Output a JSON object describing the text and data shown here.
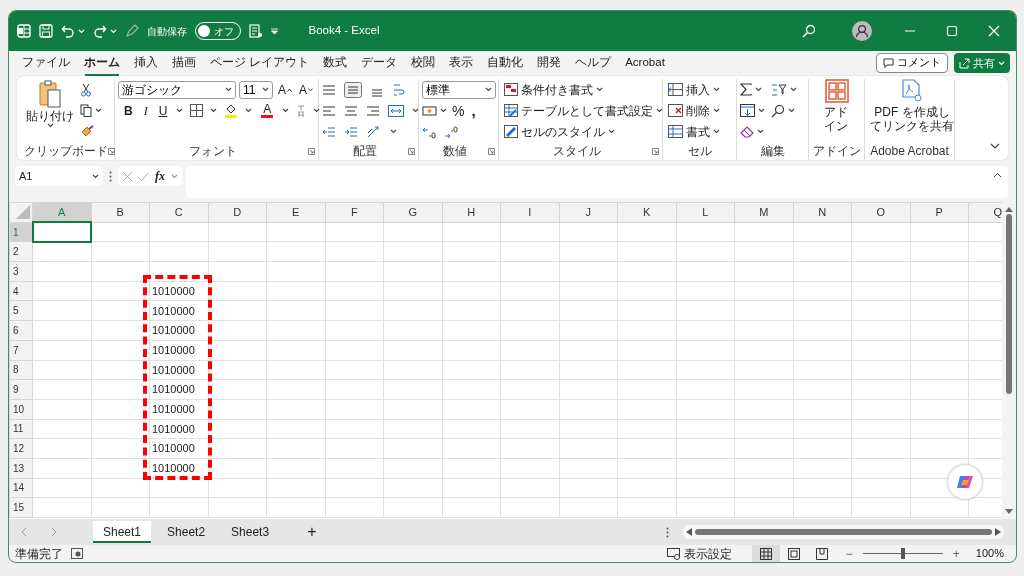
{
  "title_bar": {
    "autosave_label": "自動保存",
    "autosave_toggle": {
      "label": "オフ",
      "on": false
    },
    "title": "Book4 - Excel"
  },
  "menu_tabs": [
    {
      "label": "ファイル",
      "selected": false
    },
    {
      "label": "ホーム",
      "selected": true
    },
    {
      "label": "挿入",
      "selected": false
    },
    {
      "label": "描画",
      "selected": false
    },
    {
      "label": "ページ レイアウト",
      "selected": false
    },
    {
      "label": "数式",
      "selected": false
    },
    {
      "label": "データ",
      "selected": false
    },
    {
      "label": "校閲",
      "selected": false
    },
    {
      "label": "表示",
      "selected": false
    },
    {
      "label": "自動化",
      "selected": false
    },
    {
      "label": "開発",
      "selected": false
    },
    {
      "label": "ヘルプ",
      "selected": false
    },
    {
      "label": "Acrobat",
      "selected": false
    }
  ],
  "comment_button": "コメント",
  "share_button": "共有",
  "ribbon": {
    "clipboard": {
      "paste": "貼り付け",
      "label": "クリップボード"
    },
    "font": {
      "font_name": "游ゴシック",
      "font_size": "11",
      "grow": "A",
      "shrink": "A",
      "bold": "B",
      "italic": "I",
      "underline": "U",
      "font_color": "A",
      "label": "フォント"
    },
    "alignment": {
      "label": "配置"
    },
    "number": {
      "format": "標準",
      "percent": "%",
      "comma": ",",
      "label": "数値"
    },
    "styles": {
      "items": [
        "条件付き書式",
        "テーブルとして書式設定",
        "セルのスタイル"
      ],
      "label": "スタイル"
    },
    "cells": {
      "items": [
        "挿入",
        "削除",
        "書式"
      ],
      "label": "セル"
    },
    "editing": {
      "label": "編集"
    },
    "addins": {
      "button": "アドイン",
      "label": "アドイン"
    },
    "acrobat": {
      "button": "PDF を作成してリンクを共有",
      "label": "Adobe Acrobat"
    }
  },
  "formula_bar": {
    "name_box": "A1",
    "fx": "fx"
  },
  "grid": {
    "columns": [
      {
        "label": "A",
        "selected": true
      },
      {
        "label": "B",
        "selected": false
      },
      {
        "label": "C",
        "selected": false
      },
      {
        "label": "D",
        "selected": false
      },
      {
        "label": "E",
        "selected": false
      },
      {
        "label": "F",
        "selected": false
      },
      {
        "label": "G",
        "selected": false
      },
      {
        "label": "H",
        "selected": false
      },
      {
        "label": "I",
        "selected": false
      },
      {
        "label": "J",
        "selected": false
      },
      {
        "label": "K",
        "selected": false
      },
      {
        "label": "L",
        "selected": false
      },
      {
        "label": "M",
        "selected": false
      },
      {
        "label": "N",
        "selected": false
      },
      {
        "label": "O",
        "selected": false
      },
      {
        "label": "P",
        "selected": false
      },
      {
        "label": "Q",
        "selected": false
      }
    ],
    "highlight_frame": true,
    "rows": [
      {
        "label": "1",
        "selected": true
      },
      {
        "label": "2",
        "selected": false
      },
      {
        "label": "3",
        "selected": false
      },
      {
        "label": "4",
        "selected": false,
        "cells": [
          null,
          null,
          "1010000"
        ]
      },
      {
        "label": "5",
        "selected": false,
        "cells": [
          null,
          null,
          "1010000"
        ]
      },
      {
        "label": "6",
        "selected": false,
        "cells": [
          null,
          null,
          "1010000"
        ]
      },
      {
        "label": "7",
        "selected": false,
        "cells": [
          null,
          null,
          "1010000"
        ]
      },
      {
        "label": "8",
        "selected": false,
        "cells": [
          null,
          null,
          "1010000"
        ]
      },
      {
        "label": "9",
        "selected": false,
        "cells": [
          null,
          null,
          "1010000"
        ]
      },
      {
        "label": "10",
        "selected": false,
        "cells": [
          null,
          null,
          "1010000"
        ]
      },
      {
        "label": "11",
        "selected": false,
        "cells": [
          null,
          null,
          "1010000"
        ]
      },
      {
        "label": "12",
        "selected": false,
        "cells": [
          null,
          null,
          "1010000"
        ]
      },
      {
        "label": "13",
        "selected": false,
        "cells": [
          null,
          null,
          "1010000"
        ]
      },
      {
        "label": "14",
        "selected": false
      },
      {
        "label": "15",
        "selected": false
      }
    ]
  },
  "sheet_tabs": [
    {
      "label": "Sheet1",
      "selected": true
    },
    {
      "label": "Sheet2",
      "selected": false
    },
    {
      "label": "Sheet3",
      "selected": false
    }
  ],
  "add_sheet": "+",
  "status_bar": {
    "status": "準備完了",
    "display_settings": "表示設定",
    "views": [
      {
        "kind": "normal",
        "selected": true
      },
      {
        "kind": "page-layout",
        "selected": false
      },
      {
        "kind": "page-break",
        "selected": false
      }
    ],
    "zoom_out": "−",
    "zoom_in": "+",
    "zoom": {
      "level": 0.5
    },
    "zoom_label": "100%"
  }
}
